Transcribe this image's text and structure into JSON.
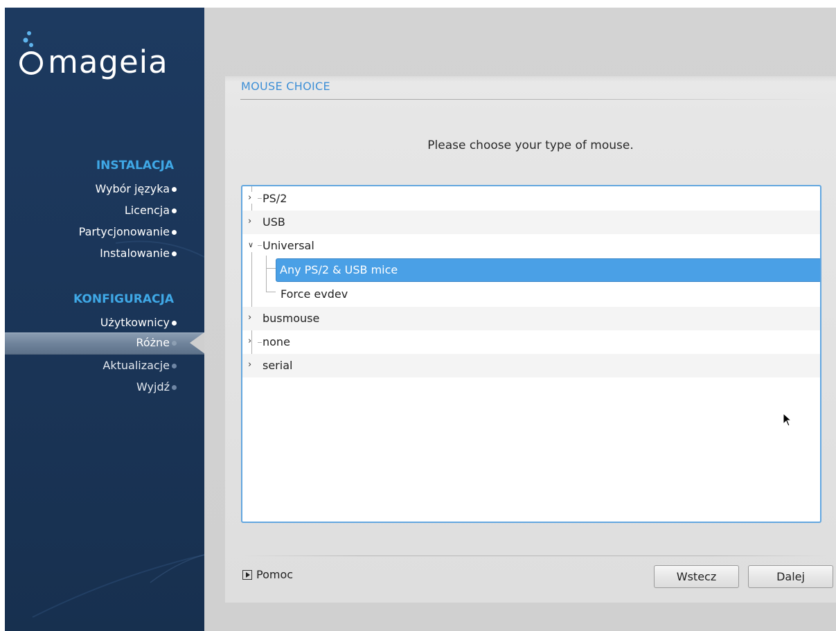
{
  "app": {
    "brand": "mageia"
  },
  "sidebar": {
    "sections": [
      {
        "title": "INSTALACJA",
        "steps": [
          {
            "label": "Wybór języka",
            "state": "done"
          },
          {
            "label": "Licencja",
            "state": "done"
          },
          {
            "label": "Partycjonowanie",
            "state": "done"
          },
          {
            "label": "Instalowanie",
            "state": "done"
          }
        ]
      },
      {
        "title": "KONFIGURACJA",
        "steps": [
          {
            "label": "Użytkownicy",
            "state": "done"
          },
          {
            "label": "Różne",
            "state": "active"
          },
          {
            "label": "Aktualizacje",
            "state": "pending"
          },
          {
            "label": "Wyjdź",
            "state": "pending"
          }
        ]
      }
    ]
  },
  "main": {
    "title": "MOUSE CHOICE",
    "prompt": "Please choose your type of mouse.",
    "tree": [
      {
        "label": "PS/2",
        "expanded": false
      },
      {
        "label": "USB",
        "expanded": false
      },
      {
        "label": "Universal",
        "expanded": true
      },
      {
        "label": "Any PS/2 & USB mice",
        "selected": true
      },
      {
        "label": "Force evdev"
      },
      {
        "label": "busmouse",
        "expanded": false
      },
      {
        "label": "none",
        "expanded": false
      },
      {
        "label": "serial",
        "expanded": false
      }
    ],
    "help_label": "Pomoc",
    "back_label": "Wstecz",
    "next_label": "Dalej"
  },
  "colors": {
    "sidebar_bg": "#1d3a60",
    "section_title": "#3fa8e6",
    "page_title": "#3d8fd6",
    "selection": "#4aa0e6",
    "tree_border": "#62a6df"
  },
  "icons": [
    "mageia-logo-icon",
    "collapsed-arrow-icon",
    "expanded-arrow-icon",
    "help-toggle-icon",
    "mouse-cursor-icon",
    "step-dot-icon"
  ]
}
